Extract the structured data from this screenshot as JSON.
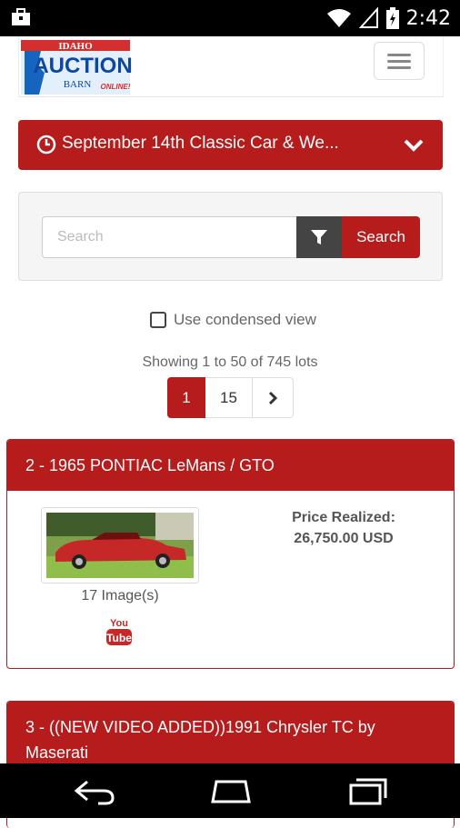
{
  "status_bar": {
    "time": "2:42"
  },
  "header": {
    "logo": {
      "line1": "IDAHO",
      "line2": "AUCTION",
      "line3": "BARN",
      "line4": "ONLINE!"
    }
  },
  "auction": {
    "title": "September 14th Classic Car & We..."
  },
  "search": {
    "placeholder": "Search",
    "button_label": "Search"
  },
  "view": {
    "condensed_label": "Use condensed view"
  },
  "pagination": {
    "summary": "Showing 1 to 50 of 745 lots",
    "current": "1",
    "last": "15"
  },
  "lots": [
    {
      "title": "2 - 1965 PONTIAC LeMans / GTO",
      "image_count": "17 Image(s)",
      "price_label": "Price Realized:",
      "price_value": "26,750.00 USD",
      "video_icon_text_1": "You",
      "video_icon_text_2": "Tube"
    },
    {
      "title": "3 - ((NEW VIDEO ADDED))1991 Chrysler TC by Maserati"
    }
  ],
  "colors": {
    "brand_red": "#b71c1c",
    "filter_dark": "#444444"
  },
  "icons": [
    "briefcase-icon",
    "wifi-icon",
    "signal-icon",
    "battery-icon",
    "clock-icon",
    "chevron-down-icon",
    "funnel-icon",
    "chevron-right-icon",
    "youtube-icon",
    "back-icon",
    "home-icon",
    "recents-icon",
    "hamburger-icon"
  ]
}
